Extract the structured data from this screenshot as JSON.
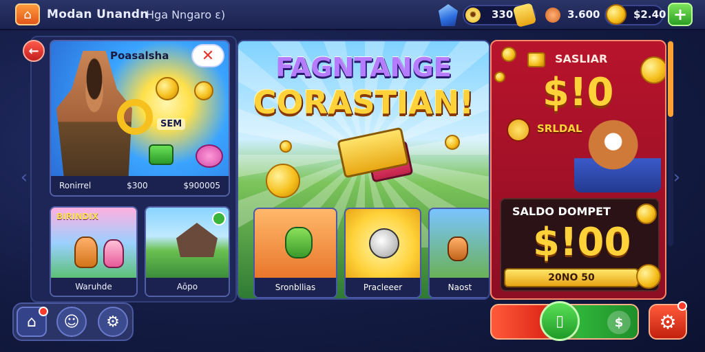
{
  "topbar": {
    "title": "Modan Unandn",
    "subtitle": "Hga Nngaro ɛ)",
    "resources": [
      {
        "icon": "gem-icon",
        "value": ""
      },
      {
        "icon": "gear-coin-icon",
        "value": "330"
      },
      {
        "icon": "copper-coin-icon",
        "value": "3.600"
      },
      {
        "icon": "gold-coin-icon",
        "value": "$2.40"
      }
    ],
    "add_label": "+"
  },
  "left_panel": {
    "hero_card": {
      "label": "Poasalsha",
      "badge": "SEM",
      "caption_left": "Ronirrel",
      "caption_mid": "$300",
      "caption_right": "$900005"
    },
    "small_cards": [
      {
        "banner": "BIRINDIX",
        "caption": "Waruhde"
      },
      {
        "caption": "Aōpo"
      }
    ]
  },
  "feature": {
    "title_line1": "FAGNTANGE",
    "title_line2": "CORASTIAN!",
    "mini_cards": [
      {
        "caption": "Sronbllias"
      },
      {
        "caption": "Pracleeer"
      },
      {
        "caption": "Naost"
      }
    ]
  },
  "promo": {
    "top_label": "SASLIAR",
    "amount": "$!0",
    "sub_label": "SRLDAL",
    "wallet_label": "SALDO DOMPET",
    "wallet_amount": "$!00",
    "wallet_bar": "20NO 50"
  },
  "colors": {
    "accent_red": "#d21e2a",
    "accent_gold": "#ffd23a",
    "accent_green": "#2fb43a",
    "bg_navy": "#141c44"
  }
}
